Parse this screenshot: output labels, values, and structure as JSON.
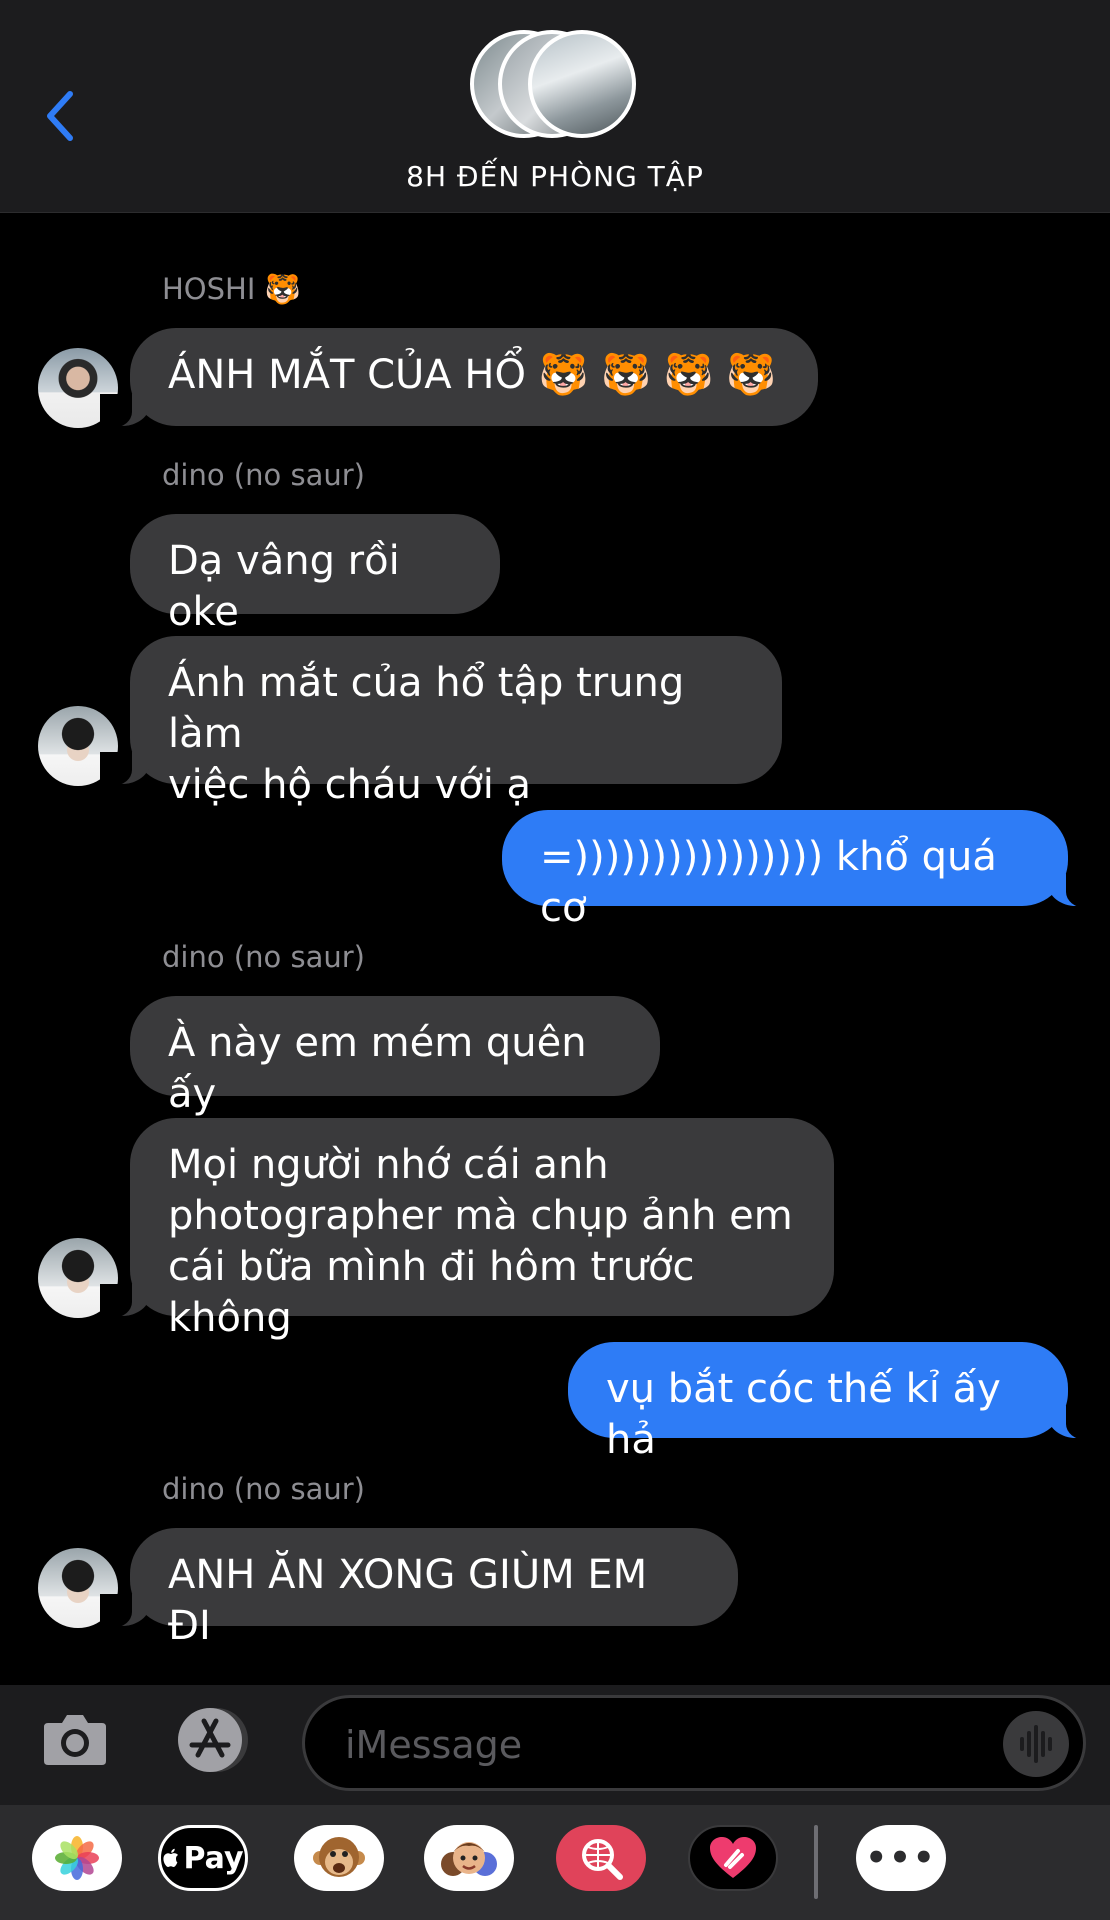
{
  "header": {
    "title": "8H ĐẾN PHÒNG TẬP"
  },
  "messages": [
    {
      "sender": "HOSHI 🐯",
      "text": "ÁNH MẮT CỦA HỔ 🐯 🐯 🐯 🐯"
    },
    {
      "sender": "dino (no saur)",
      "text": "Dạ vâng rồi oke"
    },
    {
      "text_line1": "Ánh mắt của hổ tập trung làm",
      "text_line2": "việc hộ cháu với ạ"
    },
    {
      "text": "=)))))))))))))))) khổ quá cơ"
    },
    {
      "sender": "dino (no saur)",
      "text": "À này em mém quên ấy"
    },
    {
      "text_line1": "Mọi người nhớ cái anh",
      "text_line2": "photographer mà chụp ảnh em",
      "text_line3": "cái bữa mình đi hôm trước không"
    },
    {
      "text": "vụ bắt cóc thế kỉ ấy hả"
    },
    {
      "sender": "dino (no saur)",
      "text": "ANH ĂN XONG GIÙM EM ĐI"
    }
  ],
  "input": {
    "placeholder": "iMessage"
  },
  "apps": {
    "apple_pay_label": "Pay",
    "more_label": "•••"
  },
  "colors": {
    "sent_bubble": "#2e7cf6",
    "received_bubble": "#3a3a3c",
    "accent": "#2f7cf6"
  }
}
